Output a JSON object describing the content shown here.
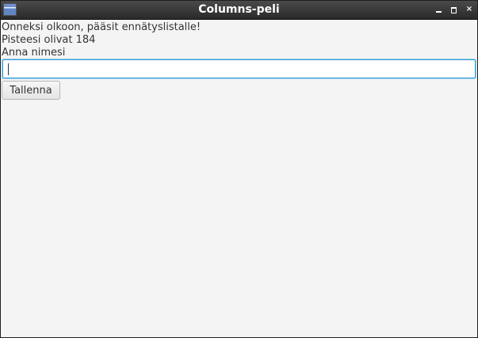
{
  "window": {
    "title": "Columns-peli",
    "controls": {
      "minimize_icon": "minimize-icon",
      "maximize_icon": "maximize-icon",
      "close_icon": "close-icon",
      "close_glyph": "×"
    }
  },
  "message": {
    "congrats": "Onneksi olkoon, pääsit ennätyslistalle!",
    "score": "Pisteesi olivat 184",
    "prompt": "Anna nimesi"
  },
  "name_input": {
    "value": "",
    "placeholder": ""
  },
  "save_button": {
    "label": "Tallenna"
  },
  "colors": {
    "titlebar": "#2f2f2f",
    "background": "#f4f4f4",
    "focus_border": "#2e9bd8",
    "text": "#333333"
  }
}
